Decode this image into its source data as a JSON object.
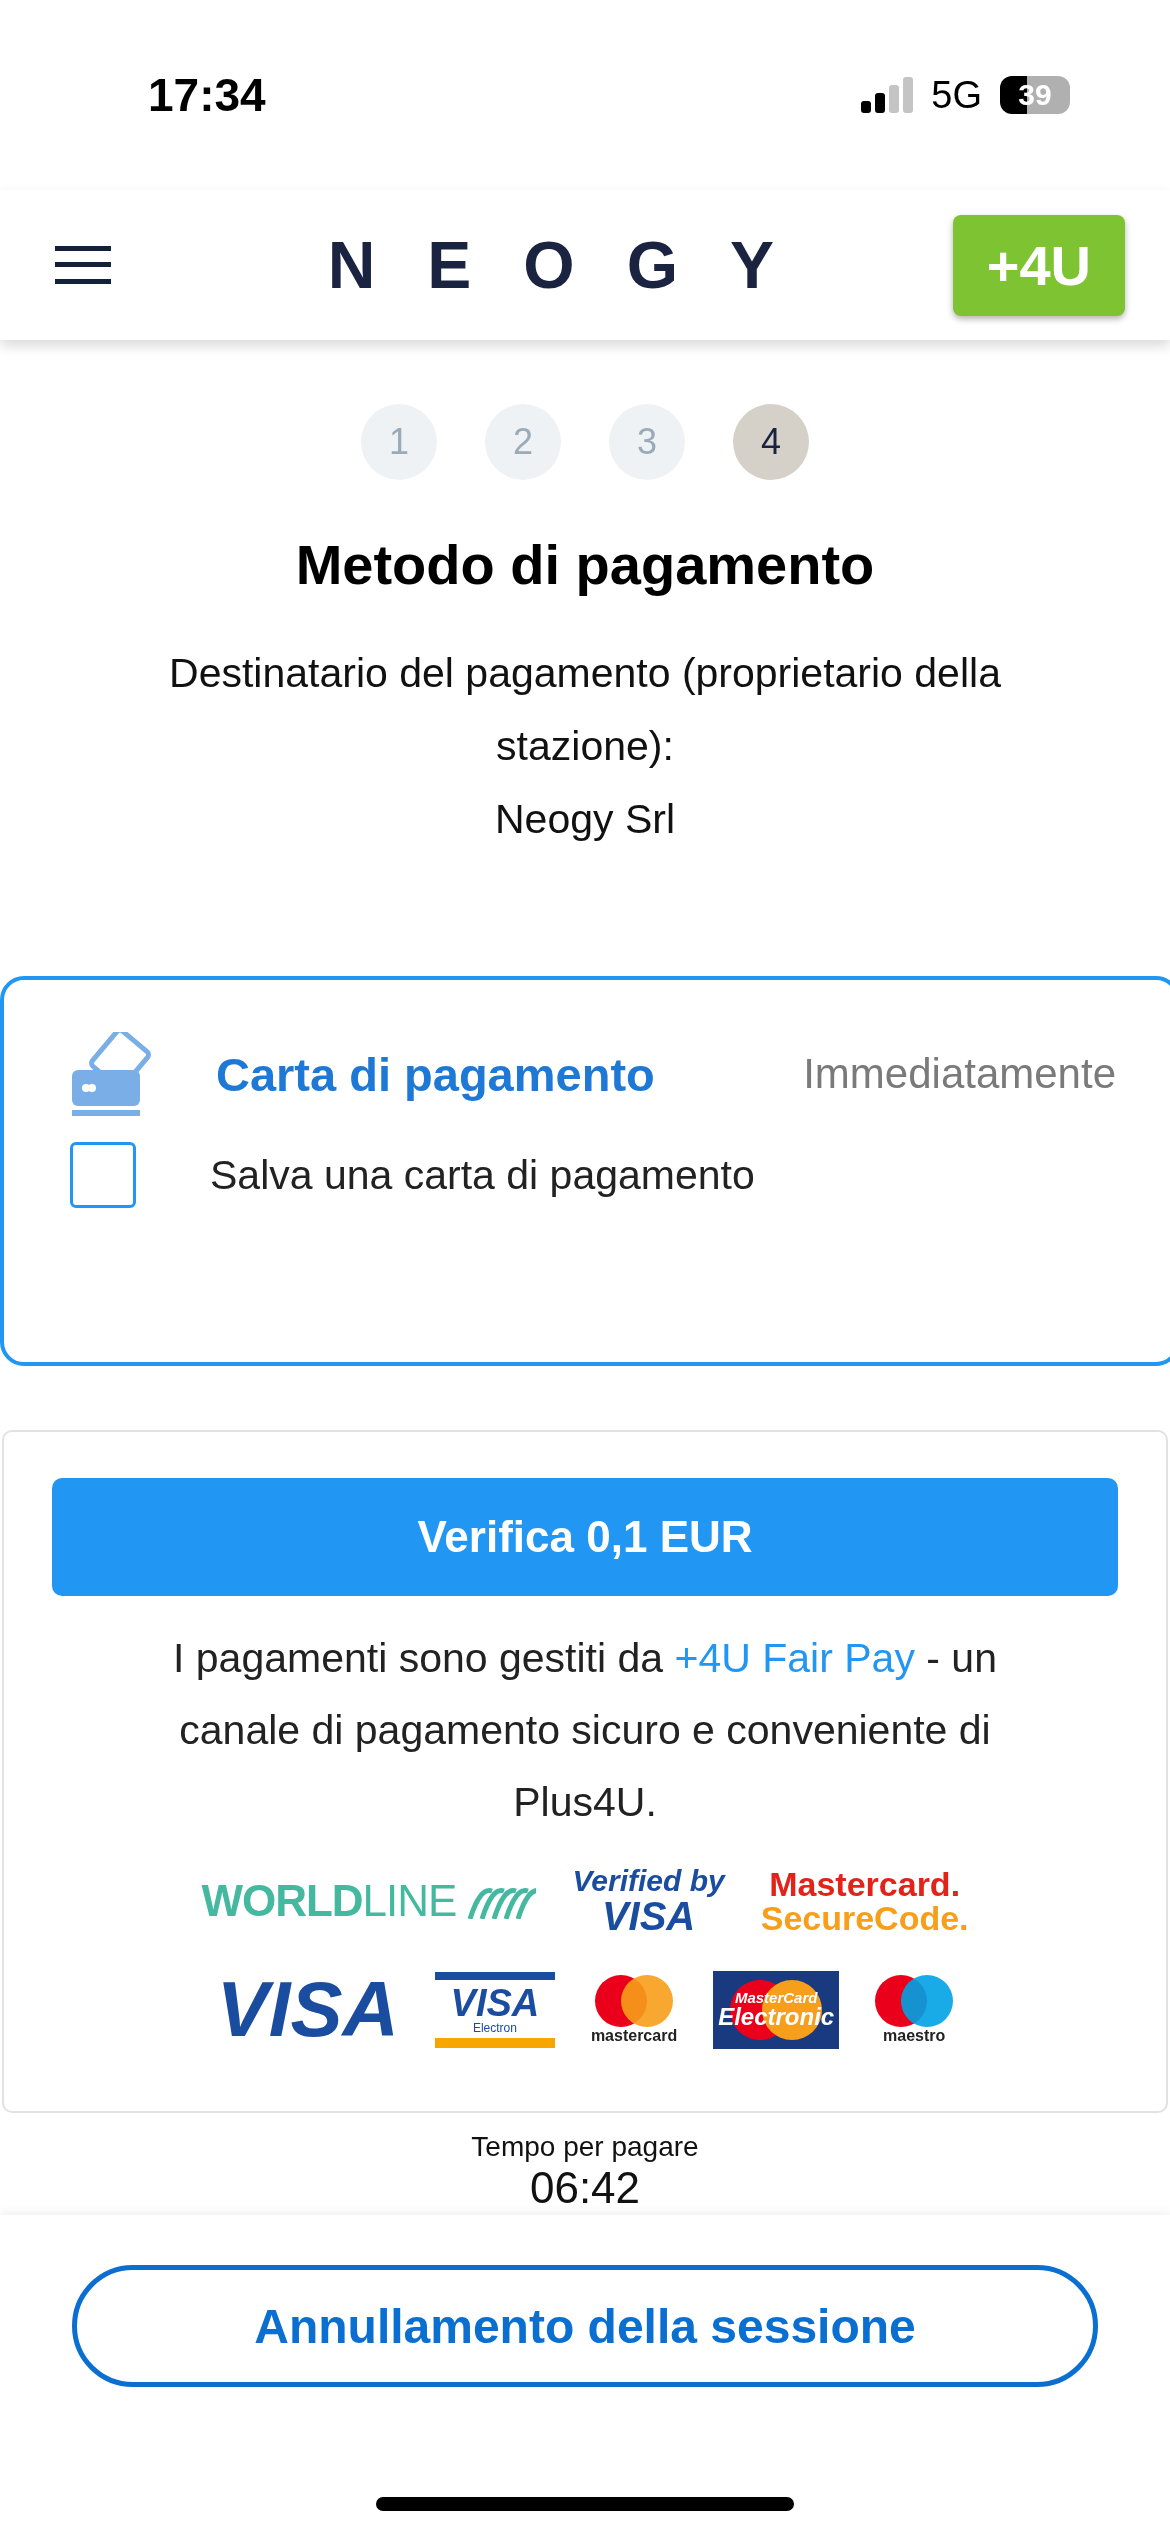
{
  "status_bar": {
    "time": "17:34",
    "network": "5G",
    "battery": "39"
  },
  "header": {
    "logo": "NEOGY",
    "badge": "+4U"
  },
  "steps": [
    {
      "label": "1",
      "selected": false
    },
    {
      "label": "2",
      "selected": false
    },
    {
      "label": "3",
      "selected": false
    },
    {
      "label": "4",
      "selected": true
    }
  ],
  "title": "Metodo di pagamento",
  "recipient": {
    "label": "Destinatario del pagamento (proprietario della stazione):",
    "name": "Neogy Srl"
  },
  "payment_method": {
    "title": "Carta di pagamento",
    "timing": "Immediatamente",
    "save_card": {
      "label": "Salva una carta di pagamento",
      "checked": false
    }
  },
  "verify_button": "Verifica 0,1 EUR",
  "info": {
    "before": "I pagamenti sono gestiti da",
    "link": "+4U Fair Pay",
    "after": "- un canale di pagamento sicuro e conveniente di Plus4U."
  },
  "logos": [
    [
      {
        "kind": "worldline",
        "lines": [
          "**WORLD**LINE"
        ]
      },
      {
        "kind": "verified",
        "lines": [
          "Verified by",
          "VISA"
        ]
      },
      {
        "kind": "securecode",
        "lines": [
          "Mastercard.",
          "SecureCode."
        ]
      }
    ],
    [
      {
        "kind": "visa",
        "lines": [
          "VISA"
        ]
      },
      {
        "kind": "electron",
        "lines": [
          "VISA",
          "Electron"
        ]
      },
      {
        "kind": "mastercard",
        "lines": [
          "mastercard"
        ]
      },
      {
        "kind": "electronic",
        "lines": [
          "MasterCard",
          "Electronic"
        ]
      },
      {
        "kind": "maestro",
        "lines": [
          "maestro"
        ]
      }
    ]
  ],
  "timer": {
    "label": "Tempo per pagare",
    "value": "06:42"
  },
  "cancel_button": "Annullamento della sessione"
}
